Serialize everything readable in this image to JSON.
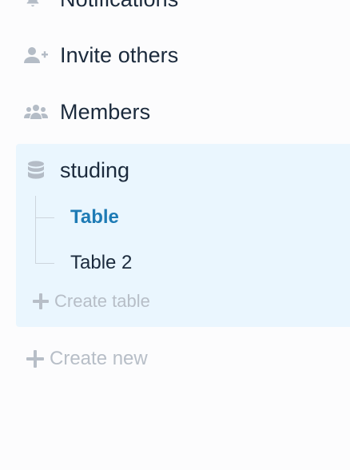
{
  "sidebar": {
    "notifications": {
      "label": "Notifications",
      "icon": "bell-icon"
    },
    "invite": {
      "label": "Invite others",
      "icon": "user-plus-icon"
    },
    "members": {
      "label": "Members",
      "icon": "users-icon"
    },
    "database": {
      "name": "studing",
      "icon": "database-icon",
      "tables": [
        {
          "label": "Table",
          "active": true
        },
        {
          "label": "Table 2",
          "active": false
        }
      ],
      "create_table_label": "Create table"
    },
    "create_new_label": "Create new"
  },
  "colors": {
    "active_text": "#1e7bb5",
    "panel_bg": "#eaf6fe",
    "icon": "#b4bcc6",
    "muted_text": "#b7bec7",
    "text": "#1b2a3c"
  }
}
